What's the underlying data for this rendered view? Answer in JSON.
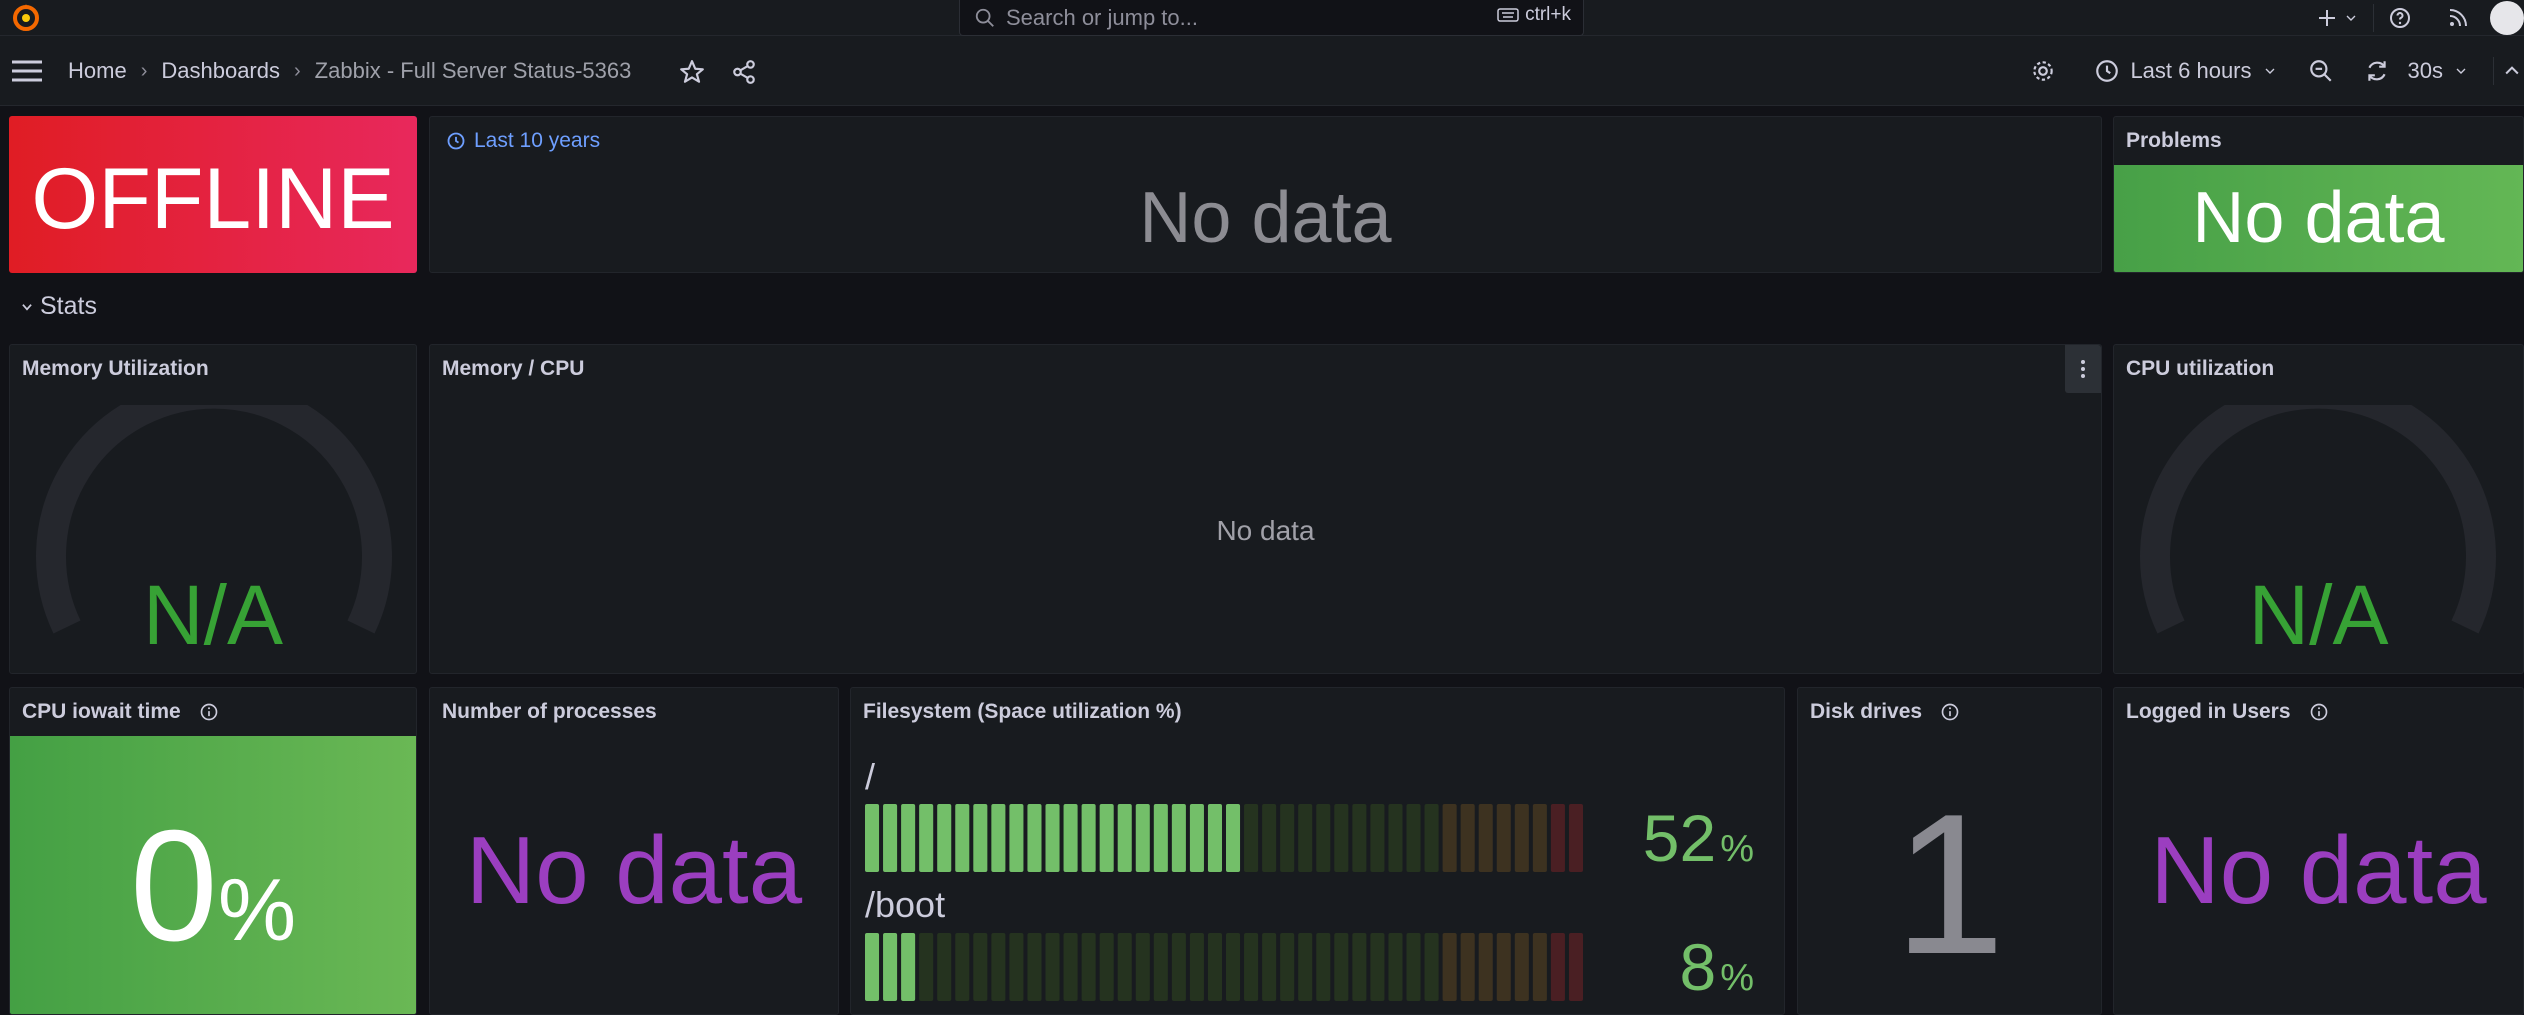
{
  "search": {
    "placeholder": "Search or jump to...",
    "shortcut": "ctrl+k"
  },
  "breadcrumb": {
    "home": "Home",
    "dashboards": "Dashboards",
    "current": "Zabbix - Full Server Status-5363"
  },
  "toolbar": {
    "time_range": "Last 6 hours",
    "refresh_interval": "30s"
  },
  "panels": {
    "status": {
      "value": "OFFLINE",
      "color": "#e01d24"
    },
    "timeline": {
      "time_override": "Last 10 years",
      "value": "No data"
    },
    "problems": {
      "title": "Problems",
      "value": "No data",
      "color": "#56a64b"
    },
    "stats_row": {
      "title": "Stats"
    },
    "memory_utilization": {
      "title": "Memory Utilization",
      "value": "N/A"
    },
    "memory_cpu": {
      "title": "Memory / CPU",
      "value": "No data"
    },
    "cpu_utilization": {
      "title": "CPU utilization",
      "value": "N/A"
    },
    "cpu_iowait": {
      "title": "CPU iowait time",
      "value": "0",
      "unit": "%"
    },
    "processes": {
      "title": "Number of processes",
      "value": "No data"
    },
    "filesystem": {
      "title": "Filesystem (Space utilization %)",
      "items": [
        {
          "name": "/",
          "value": "52",
          "unit": "%",
          "fraction": 0.52
        },
        {
          "name": "/boot",
          "value": "8",
          "unit": "%",
          "fraction": 0.08
        }
      ]
    },
    "disk_drives": {
      "title": "Disk drives",
      "value": "1"
    },
    "logged_users": {
      "title": "Logged in Users",
      "value": "No data"
    }
  },
  "colors": {
    "accent_blue": "#6e9fff",
    "ok_green": "#73bf69",
    "purple": "#9b3ec0",
    "gauge_green": "#37a235"
  }
}
